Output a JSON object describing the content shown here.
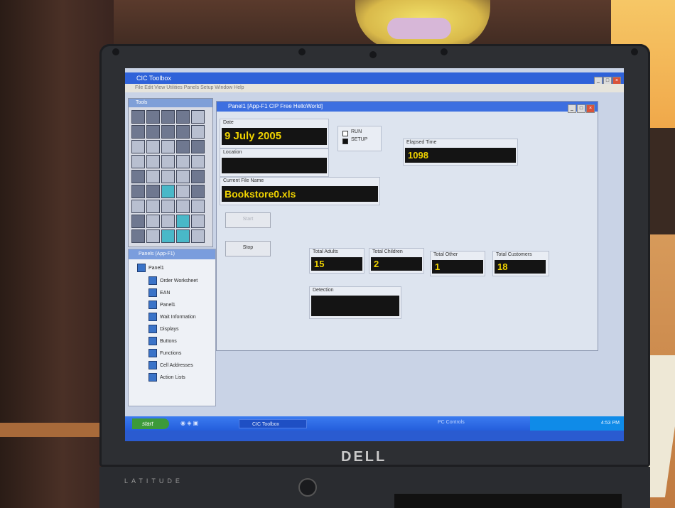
{
  "app": {
    "title": "CIC Toolbox",
    "menu": "File  Edit  View  Utilities  Panels  Setup  Window  Help"
  },
  "tools": {
    "title": "Tools"
  },
  "tree": {
    "title": "Panels (App-F1)",
    "root": "Panel1",
    "items": [
      "Order Worksheet",
      "EAN",
      "Panel1",
      "Wait Information",
      "Displays",
      "Buttons",
      "Functions",
      "Cell Addresses",
      "Action Lists"
    ]
  },
  "panel": {
    "title": "Panel1 [App-F1 CIP Free HelloWorld]",
    "date_label": "Date",
    "date_value": "9 July 2005",
    "location_label": "Location",
    "location_value": "",
    "radio_run": "RUN",
    "radio_setup": "SETUP",
    "elapsed_label": "Elapsed Time",
    "elapsed_value": "1098",
    "filename_label": "Current File Name",
    "filename_value": "Bookstore0.xls",
    "start_button": "Start",
    "stop_button": "Stop",
    "adults_label": "Total Adults",
    "adults_value": "15",
    "children_label": "Total Children",
    "children_value": "2",
    "other_label": "Total Other",
    "other_value": "1",
    "customers_label": "Total Customers",
    "customers_value": "18",
    "detection_label": "Detection",
    "detection_value": ""
  },
  "taskbar": {
    "start": "start",
    "task": "CIC Toolbox",
    "notify": "PC Controls",
    "clock": "4:53 PM"
  },
  "laptop": {
    "brand": "DELL",
    "model": "LATITUDE"
  },
  "colors": {
    "lcd_bg": "#141414",
    "lcd_text": "#f0d300",
    "xp_blue": "#2a5bd0"
  }
}
